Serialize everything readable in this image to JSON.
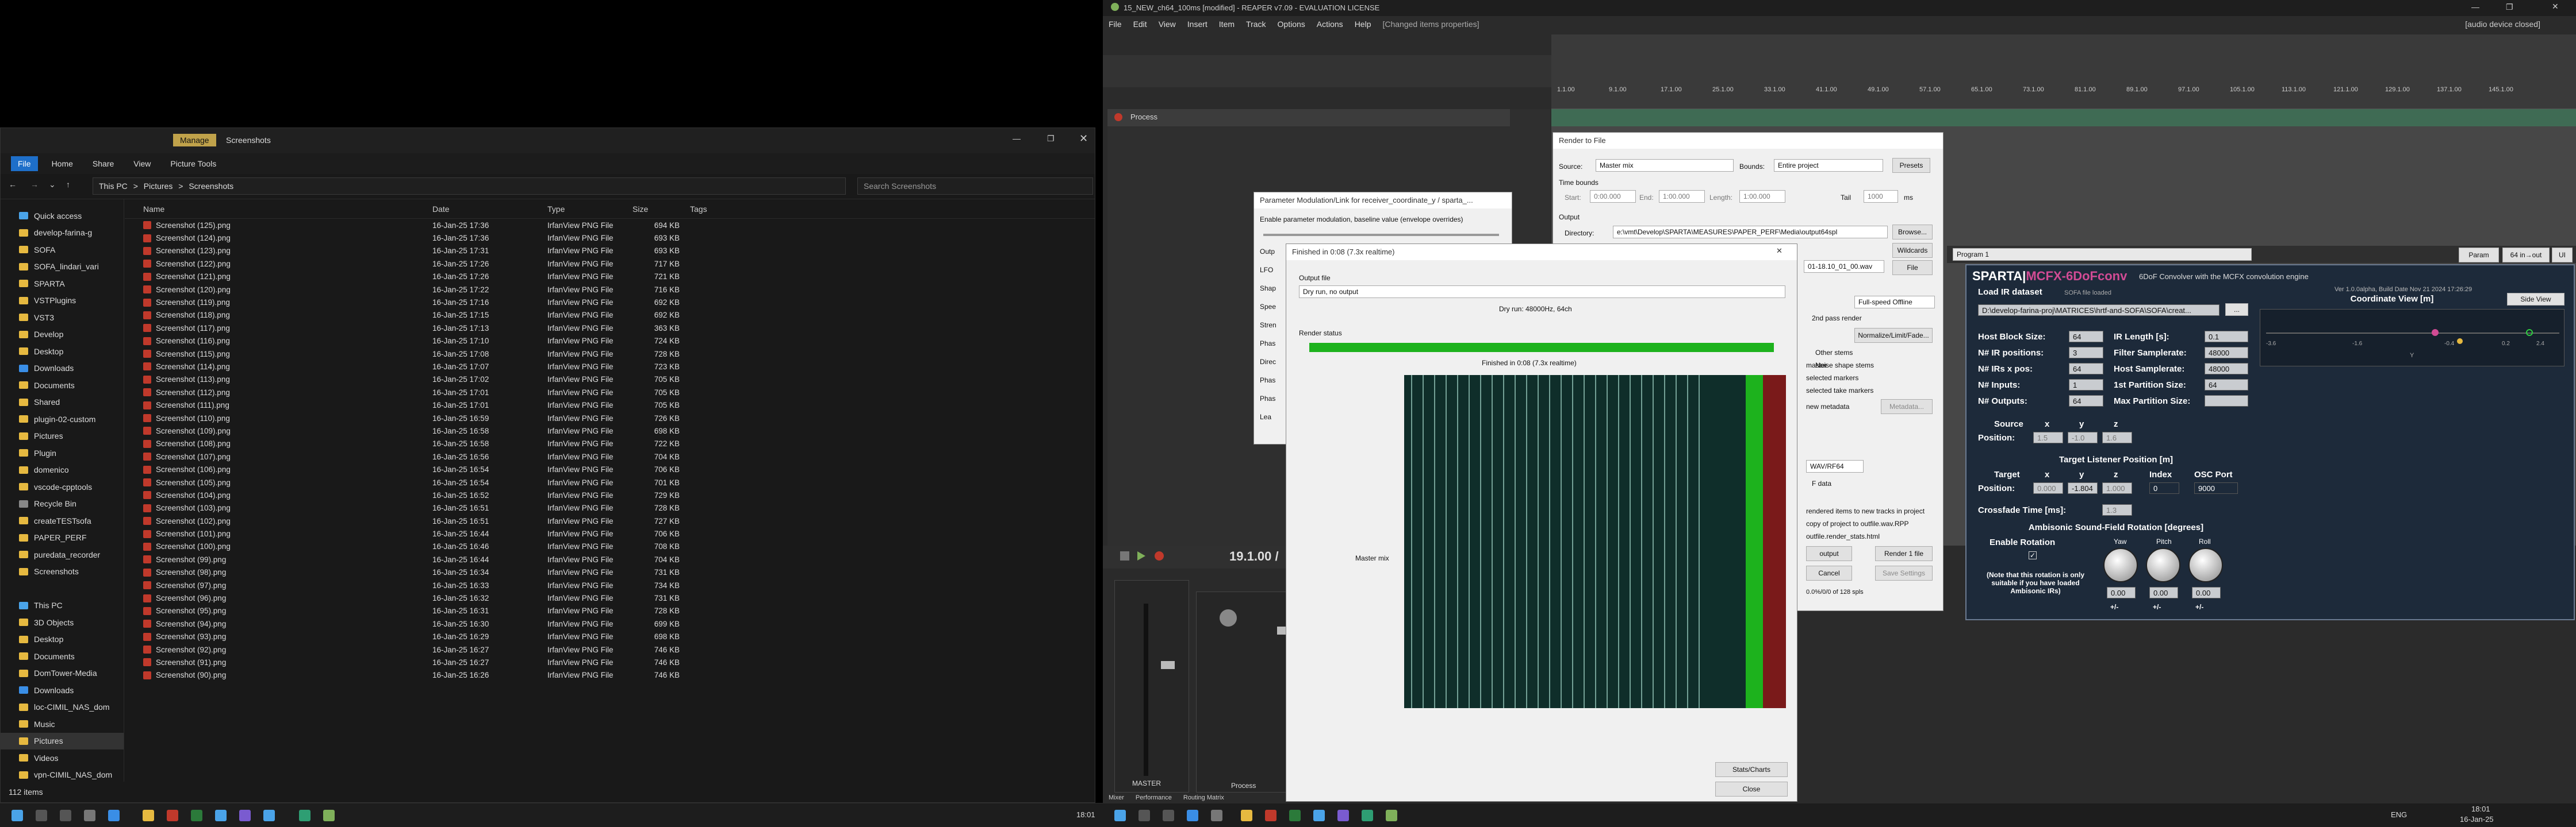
{
  "explorer": {
    "tab_manage": "Manage",
    "title": "Screenshots",
    "ribbon": [
      "File",
      "Home",
      "Share",
      "View",
      "Picture Tools"
    ],
    "breadcrumb": [
      "This PC",
      ">",
      "Pictures",
      ">",
      "Screenshots"
    ],
    "search_placeholder": "Search Screenshots",
    "nav": [
      {
        "label": "Quick access",
        "icon": "star-icon"
      },
      {
        "label": "develop-farina-g",
        "icon": "folder-icon"
      },
      {
        "label": "SOFA",
        "icon": "folder-icon"
      },
      {
        "label": "SOFA_lindari_vari",
        "icon": "folder-icon"
      },
      {
        "label": "SPARTA",
        "icon": "folder-icon"
      },
      {
        "label": "VSTPlugins",
        "icon": "folder-icon"
      },
      {
        "label": "VST3",
        "icon": "folder-icon"
      },
      {
        "label": "Develop",
        "icon": "folder-icon"
      },
      {
        "label": "Desktop",
        "icon": "folder-icon"
      },
      {
        "label": "Downloads",
        "icon": "download-icon"
      },
      {
        "label": "Documents",
        "icon": "folder-icon"
      },
      {
        "label": "Shared",
        "icon": "folder-icon"
      },
      {
        "label": "plugin-02-custom",
        "icon": "folder-icon"
      },
      {
        "label": "Pictures",
        "icon": "folder-icon"
      },
      {
        "label": "Plugin",
        "icon": "folder-icon"
      },
      {
        "label": "domenico",
        "icon": "folder-icon"
      },
      {
        "label": "vscode-cpptools",
        "icon": "folder-icon"
      },
      {
        "label": "Recycle Bin",
        "icon": "recycle-icon"
      },
      {
        "label": "createTESTsofa",
        "icon": "folder-icon"
      },
      {
        "label": "PAPER_PERF",
        "icon": "folder-icon"
      },
      {
        "label": "puredata_recorder",
        "icon": "folder-icon"
      },
      {
        "label": "Screenshots",
        "icon": "folder-icon"
      },
      {
        "label": "",
        "icon": ""
      },
      {
        "label": "This PC",
        "icon": "pc-icon"
      },
      {
        "label": "3D Objects",
        "icon": "folder-icon"
      },
      {
        "label": "Desktop",
        "icon": "folder-icon"
      },
      {
        "label": "Documents",
        "icon": "folder-icon"
      },
      {
        "label": "DomTower-Media",
        "icon": "folder-icon"
      },
      {
        "label": "Downloads",
        "icon": "download-icon"
      },
      {
        "label": "loc-CIMIL_NAS_dom",
        "icon": "folder-icon"
      },
      {
        "label": "Music",
        "icon": "folder-icon"
      },
      {
        "label": "Pictures",
        "icon": "folder-icon"
      },
      {
        "label": "Videos",
        "icon": "folder-icon"
      },
      {
        "label": "vpn-CIMIL_NAS_dom",
        "icon": "folder-icon"
      }
    ],
    "columns": [
      "Name",
      "Date",
      "Type",
      "Size",
      "Tags"
    ],
    "files": [
      [
        "Screenshot (125).png",
        "16-Jan-25 17:36",
        "IrfanView PNG File",
        "694 KB"
      ],
      [
        "Screenshot (124).png",
        "16-Jan-25 17:36",
        "IrfanView PNG File",
        "693 KB"
      ],
      [
        "Screenshot (123).png",
        "16-Jan-25 17:31",
        "IrfanView PNG File",
        "693 KB"
      ],
      [
        "Screenshot (122).png",
        "16-Jan-25 17:26",
        "IrfanView PNG File",
        "717 KB"
      ],
      [
        "Screenshot (121).png",
        "16-Jan-25 17:26",
        "IrfanView PNG File",
        "721 KB"
      ],
      [
        "Screenshot (120).png",
        "16-Jan-25 17:22",
        "IrfanView PNG File",
        "716 KB"
      ],
      [
        "Screenshot (119).png",
        "16-Jan-25 17:16",
        "IrfanView PNG File",
        "692 KB"
      ],
      [
        "Screenshot (118).png",
        "16-Jan-25 17:15",
        "IrfanView PNG File",
        "692 KB"
      ],
      [
        "Screenshot (117).png",
        "16-Jan-25 17:13",
        "IrfanView PNG File",
        "363 KB"
      ],
      [
        "Screenshot (116).png",
        "16-Jan-25 17:10",
        "IrfanView PNG File",
        "724 KB"
      ],
      [
        "Screenshot (115).png",
        "16-Jan-25 17:08",
        "IrfanView PNG File",
        "728 KB"
      ],
      [
        "Screenshot (114).png",
        "16-Jan-25 17:07",
        "IrfanView PNG File",
        "723 KB"
      ],
      [
        "Screenshot (113).png",
        "16-Jan-25 17:02",
        "IrfanView PNG File",
        "705 KB"
      ],
      [
        "Screenshot (112).png",
        "16-Jan-25 17:01",
        "IrfanView PNG File",
        "705 KB"
      ],
      [
        "Screenshot (111).png",
        "16-Jan-25 17:01",
        "IrfanView PNG File",
        "705 KB"
      ],
      [
        "Screenshot (110).png",
        "16-Jan-25 16:59",
        "IrfanView PNG File",
        "726 KB"
      ],
      [
        "Screenshot (109).png",
        "16-Jan-25 16:58",
        "IrfanView PNG File",
        "698 KB"
      ],
      [
        "Screenshot (108).png",
        "16-Jan-25 16:58",
        "IrfanView PNG File",
        "722 KB"
      ],
      [
        "Screenshot (107).png",
        "16-Jan-25 16:56",
        "IrfanView PNG File",
        "704 KB"
      ],
      [
        "Screenshot (106).png",
        "16-Jan-25 16:54",
        "IrfanView PNG File",
        "706 KB"
      ],
      [
        "Screenshot (105).png",
        "16-Jan-25 16:54",
        "IrfanView PNG File",
        "701 KB"
      ],
      [
        "Screenshot (104).png",
        "16-Jan-25 16:52",
        "IrfanView PNG File",
        "729 KB"
      ],
      [
        "Screenshot (103).png",
        "16-Jan-25 16:51",
        "IrfanView PNG File",
        "728 KB"
      ],
      [
        "Screenshot (102).png",
        "16-Jan-25 16:51",
        "IrfanView PNG File",
        "727 KB"
      ],
      [
        "Screenshot (101).png",
        "16-Jan-25 16:44",
        "IrfanView PNG File",
        "706 KB"
      ],
      [
        "Screenshot (100).png",
        "16-Jan-25 16:46",
        "IrfanView PNG File",
        "708 KB"
      ],
      [
        "Screenshot (99).png",
        "16-Jan-25 16:44",
        "IrfanView PNG File",
        "704 KB"
      ],
      [
        "Screenshot (98).png",
        "16-Jan-25 16:34",
        "IrfanView PNG File",
        "731 KB"
      ],
      [
        "Screenshot (97).png",
        "16-Jan-25 16:33",
        "IrfanView PNG File",
        "734 KB"
      ],
      [
        "Screenshot (96).png",
        "16-Jan-25 16:32",
        "IrfanView PNG File",
        "731 KB"
      ],
      [
        "Screenshot (95).png",
        "16-Jan-25 16:31",
        "IrfanView PNG File",
        "728 KB"
      ],
      [
        "Screenshot (94).png",
        "16-Jan-25 16:30",
        "IrfanView PNG File",
        "699 KB"
      ],
      [
        "Screenshot (93).png",
        "16-Jan-25 16:29",
        "IrfanView PNG File",
        "698 KB"
      ],
      [
        "Screenshot (92).png",
        "16-Jan-25 16:27",
        "IrfanView PNG File",
        "746 KB"
      ],
      [
        "Screenshot (91).png",
        "16-Jan-25 16:27",
        "IrfanView PNG File",
        "746 KB"
      ],
      [
        "Screenshot (90).png",
        "16-Jan-25 16:26",
        "IrfanView PNG File",
        "746 KB"
      ]
    ],
    "status": "112 items"
  },
  "reaper": {
    "title": "15_NEW_ch64_100ms [modified] - REAPER v7.09 - EVALUATION LICENSE",
    "menu": [
      "File",
      "Edit",
      "View",
      "Insert",
      "Item",
      "Track",
      "Options",
      "Actions",
      "Help",
      "[Changed items properties]"
    ],
    "audio_status": "[audio device closed]",
    "ruler": [
      "1.1.00",
      "9.1.00",
      "17.1.00",
      "25.1.00",
      "33.1.00",
      "41.1.00",
      "49.1.00",
      "57.1.00",
      "65.1.00",
      "73.1.00",
      "81.1.00",
      "89.1.00",
      "97.1.00",
      "105.1.00",
      "113.1.00",
      "121.1.00",
      "129.1.00",
      "137.1.00",
      "145.1.00"
    ],
    "track_name": "Process",
    "transport_time": "19.1.00 /",
    "mixer_label": "MASTER",
    "mixer_process_label": "Process",
    "bottom_tabs": [
      "Mixer",
      "Performance",
      "Routing Matrix"
    ]
  },
  "render_to_file": {
    "title": "Render to File",
    "source_label": "Source:",
    "source_value": "Master mix",
    "bounds_label": "Bounds:",
    "bounds_value": "Entire project",
    "presets": "Presets",
    "time_bounds": "Time bounds",
    "start_label": "Start:",
    "start_value": "0:00.000",
    "end_label": "End:",
    "end_value": "1:00.000",
    "length_label": "Length:",
    "length_value": "1:00.000",
    "tail_label": "Tail",
    "tail_value": "1000",
    "tail_unit": "ms",
    "output": "Output",
    "directory_label": "Directory:",
    "directory_value": "e:\\vmt\\Develop\\SPARTA\\MEASURES\\PAPER_PERF\\Media\\output64spl",
    "browse": "Browse...",
    "wildcards": "Wildcards",
    "file_value": "01-18.10_01_00.wav",
    "file_btn": "File",
    "offline": "Full-speed Offline",
    "pass2": "2nd pass render",
    "normalize": "Normalize/Limit/Fade...",
    "other_stems": "Other stems",
    "noise_shape": "Noise shape stems",
    "master": "master",
    "markers": "selected markers",
    "take_markers": "selected take markers",
    "metadata_label": "new metadata",
    "metadata_btn": "Metadata...",
    "format": "WAV/RF64",
    "data": "F data",
    "rendered_items": "rendered items to new tracks in project",
    "copy_project": "copy of project to outfile.wav.RPP",
    "stats_file": "outfile.render_stats.html",
    "output_btn": "output",
    "render_btn": "Render 1 file",
    "cancel": "Cancel",
    "save_settings": "Save Settings",
    "latency": "0.0%/0/0 of 128 spls"
  },
  "param_dialog": {
    "title": "Parameter Modulation/Link for receiver_coordinate_y / sparta_...",
    "enable": "Enable parameter modulation, baseline value (envelope overrides)",
    "labels": [
      "Outp",
      "LFO",
      "Shap",
      "Spee",
      "Stren",
      "Phas",
      "Direc",
      "Phas",
      "Phas",
      "Lea"
    ]
  },
  "finished": {
    "title": "Finished in 0:08  (7.3x realtime)",
    "output_file": "Output file",
    "output_value": "Dry run, no output",
    "format": "Dry run: 48000Hz, 64ch",
    "render_status": "Render status",
    "progress": 1.0,
    "status_text": "Finished in 0:08    (7.3x realtime)",
    "master_mix": "Master mix",
    "stats": "Stats/Charts",
    "close": "Close"
  },
  "sparta": {
    "program": "Program 1",
    "param_btn": "Param",
    "inout": "64 in→out",
    "ui_btn": "UI",
    "title_prefix": "SPARTA|",
    "title_accent": "MCFX-6DoFconv",
    "subtitle": "6DoF Convolver with the MCFX convolution engine",
    "version": "Ver 1.0.0alpha, Build Date Nov 21 2024 17:26:29",
    "load_ir": "Load IR dataset",
    "sofa_status": "SOFA file loaded",
    "ir_path": "D:\\develop-farina-proj\\MATRICES\\hrtf-and-SOFA\\SOFA\\creat...",
    "browse": "...",
    "host_block_label": "Host Block Size:",
    "host_block": "64",
    "ir_length_label": "IR Length [s]:",
    "ir_length": "0.1",
    "ir_positions_label": "N# IR positions:",
    "ir_positions": "3",
    "filter_sr_label": "Filter Samplerate:",
    "filter_sr": "48000",
    "irs_xpos_label": "N# IRs x pos:",
    "irs_xpos": "64",
    "host_sr_label": "Host Samplerate:",
    "host_sr": "48000",
    "inputs_label": "N# Inputs:",
    "inputs": "1",
    "first_part_label": "1st Partition Size:",
    "first_part": "64",
    "outputs_label": "N# Outputs:",
    "outputs": "64",
    "max_part_label": "Max Partition Size:",
    "max_part": "",
    "coord_view": "Coordinate View [m]",
    "side_view": "Side View",
    "coord_ticks": [
      "-3.6",
      "-1.6",
      "-0.4",
      "0.2",
      "2.4"
    ],
    "coord_axis": "Y",
    "source_label": "Source",
    "position_label": "Position:",
    "x": "x",
    "y": "y",
    "z": "z",
    "src_x": "1.5",
    "src_y": "-1.0",
    "src_z": "1.6",
    "target_header": "Target Listener Position [m]",
    "target_label": "Target",
    "index_label": "Index",
    "osc_label": "OSC Port",
    "tgt_x": "0.000",
    "tgt_y": "-1.804",
    "tgt_z": "1.000",
    "index": "0",
    "osc": "9000",
    "crossfade_label": "Crossfade Time [ms]:",
    "crossfade": "1.3",
    "rotation_header": "Ambisonic Sound-Field Rotation [degrees]",
    "enable_rotation": "Enable Rotation",
    "note": "(Note that this rotation is only suitable if you have loaded Ambisonic IRs)",
    "yaw_label": "Yaw",
    "pitch_label": "Pitch",
    "roll_label": "Roll",
    "yaw": "0.00",
    "pitch": "0.00",
    "roll": "0.00",
    "flip": "+/-"
  },
  "taskbar_left": {
    "time": "18:01"
  },
  "taskbar_right": {
    "lang": "ENG",
    "time": "18:01",
    "date": "16-Jan-25"
  }
}
